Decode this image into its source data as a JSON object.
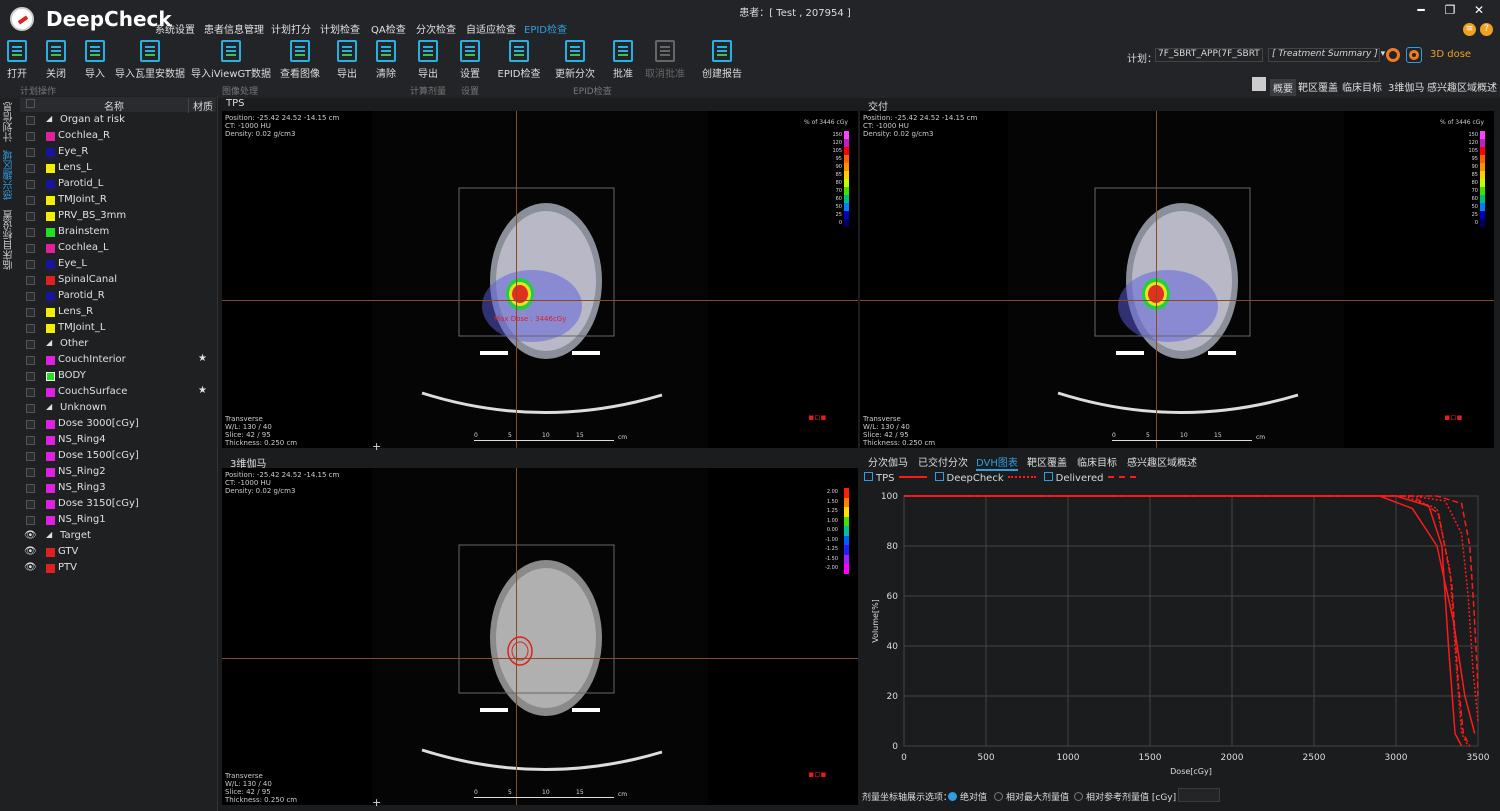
{
  "app": {
    "name": "DeepCheck",
    "patient": "患者：[ Test , 207954 ]"
  },
  "menu": [
    "系统设置",
    "患者信息管理",
    "计划打分",
    "计划检查",
    "QA检查",
    "分次检查",
    "自适应检查",
    "EPID检查"
  ],
  "toolbar": {
    "buttons": [
      "打开",
      "关闭",
      "导入",
      "导入瓦里安数据",
      "导入iViewGT数据",
      "查看图像",
      "导出",
      "清除",
      "导出",
      "设置",
      "EPID检查",
      "更新分次",
      "批准",
      "取消批准",
      "创建报告"
    ],
    "groups": [
      "计划操作",
      "图像处理",
      "计算剂量",
      "设置",
      "EPID检查"
    ]
  },
  "plan": {
    "label": "计划：",
    "value": "7F_SBRT_APP(7F_SBRT",
    "summary": "[ Treatment Summary ]",
    "dose3d": "3D dose"
  },
  "right_tabs": [
    "概要",
    "靶区覆盖",
    "临床目标",
    "3维伽马",
    "感兴趣区域概述"
  ],
  "side_tabs": [
    "计划信息",
    "感兴趣区域",
    "临床目标设置"
  ],
  "struct_header": {
    "name": "名称",
    "material": "材质"
  },
  "structures": [
    {
      "type": "group",
      "label": "Organ at risk"
    },
    {
      "label": "Cochlea_R",
      "color": "#e0209a"
    },
    {
      "label": "Eye_R",
      "color": "#1515a0"
    },
    {
      "label": "Lens_L",
      "color": "#f0f000"
    },
    {
      "label": "Parotid_L",
      "color": "#1515a0"
    },
    {
      "label": "TMJoint_R",
      "color": "#f0f000"
    },
    {
      "label": "PRV_BS_3mm",
      "color": "#f0f000"
    },
    {
      "label": "Brainstem",
      "color": "#20e020"
    },
    {
      "label": "Cochlea_L",
      "color": "#e0209a"
    },
    {
      "label": "Eye_L",
      "color": "#1515a0"
    },
    {
      "label": "SpinalCanal",
      "color": "#e02020"
    },
    {
      "label": "Parotid_R",
      "color": "#1515a0"
    },
    {
      "label": "Lens_R",
      "color": "#f0f000"
    },
    {
      "label": "TMJoint_L",
      "color": "#f0f000"
    },
    {
      "type": "group",
      "label": "Other"
    },
    {
      "label": "CouchInterior",
      "color": "#e020e0",
      "star": "★"
    },
    {
      "label": "BODY",
      "color": "#20e020"
    },
    {
      "label": "CouchSurface",
      "color": "#e020e0",
      "star": "★"
    },
    {
      "type": "group",
      "label": "Unknown"
    },
    {
      "label": "Dose 3000[cGy]",
      "color": "#e020e0"
    },
    {
      "label": "NS_Ring4",
      "color": "#e020e0"
    },
    {
      "label": "Dose 1500[cGy]",
      "color": "#e020e0"
    },
    {
      "label": "NS_Ring2",
      "color": "#e020e0"
    },
    {
      "label": "NS_Ring3",
      "color": "#e020e0"
    },
    {
      "label": "Dose 3150[cGy]",
      "color": "#e020e0"
    },
    {
      "label": "NS_Ring1",
      "color": "#e020e0"
    },
    {
      "type": "group",
      "label": "Target",
      "eye": true
    },
    {
      "label": "GTV",
      "color": "#e02020",
      "eye": true
    },
    {
      "label": "PTV",
      "color": "#e02020",
      "eye": true
    }
  ],
  "panels": {
    "tps": "TPS",
    "delivered": "交付",
    "gamma3d": "3维伽马",
    "info_top": "Position: -25.42 24.52 -14.15 cm\nCT: -1000 HU\nDensity: 0.02 g/cm3",
    "info_bottom": "Transverse\nW/L: 130 / 40\nSlice: 42 / 95\nThickness: 0.250 cm",
    "maxdose": "Max Dose : 3446cGy",
    "colorbar_title": "% of 3446 cGy",
    "dose_ticks": [
      "150",
      "120",
      "105",
      "95",
      "90",
      "85",
      "80",
      "70",
      "60",
      "50",
      "25",
      "0"
    ],
    "gamma_ticks": [
      "2.00",
      "1.50",
      "1.25",
      "1.00",
      "0.00",
      "-1.00",
      "-1.25",
      "-1.50",
      "-2.00"
    ],
    "scale_ticks": [
      "0",
      "5",
      "10",
      "15"
    ],
    "scale_unit": "cm"
  },
  "bottom_tabs": [
    "分次伽马",
    "已交付分次",
    "DVH图表",
    "靶区覆盖",
    "临床目标",
    "感兴趣区域概述"
  ],
  "chart_legend": [
    "TPS",
    "DeepCheck",
    "Delivered"
  ],
  "chart_data": {
    "type": "line",
    "xlabel": "Dose[cGy]",
    "ylabel": "Volume[%]",
    "xlim": [
      0,
      3500
    ],
    "ylim": [
      0,
      100
    ],
    "xticks": [
      0,
      500,
      1000,
      1500,
      2000,
      2500,
      3000,
      3500
    ],
    "yticks": [
      0,
      20,
      40,
      60,
      80,
      100
    ],
    "grid": true,
    "series": [
      {
        "name": "TPS",
        "style": "solid",
        "x": [
          0,
          3000,
          3200,
          3280,
          3320,
          3360,
          3400
        ],
        "y": [
          100,
          100,
          96,
          80,
          40,
          5,
          0
        ]
      },
      {
        "name": "TPS",
        "style": "solid",
        "x": [
          0,
          2900,
          3100,
          3250,
          3350,
          3420,
          3480
        ],
        "y": [
          100,
          100,
          95,
          80,
          50,
          20,
          5
        ]
      },
      {
        "name": "DeepCheck",
        "style": "dotted",
        "x": [
          0,
          3050,
          3250,
          3330,
          3370,
          3400,
          3440
        ],
        "y": [
          100,
          100,
          95,
          70,
          30,
          5,
          0
        ]
      },
      {
        "name": "DeepCheck",
        "style": "dotted",
        "x": [
          0,
          3100,
          3300,
          3400,
          3440,
          3470,
          3500
        ],
        "y": [
          100,
          100,
          98,
          85,
          60,
          30,
          10
        ]
      },
      {
        "name": "Delivered",
        "style": "dashed",
        "x": [
          0,
          3100,
          3260,
          3340,
          3380,
          3410,
          3450
        ],
        "y": [
          100,
          100,
          93,
          65,
          25,
          5,
          0
        ]
      },
      {
        "name": "Delivered",
        "style": "dashed",
        "x": [
          0,
          3250,
          3400,
          3450,
          3475,
          3495,
          3500
        ],
        "y": [
          100,
          100,
          97,
          80,
          55,
          30,
          20
        ]
      }
    ]
  },
  "options": {
    "label": "剂量坐标轴展示选项：",
    "items": [
      "绝对值",
      "相对最大剂量值",
      "相对参考剂量值 [cGy]"
    ],
    "selected": 0
  },
  "colors": {
    "accent": "#2f9de0",
    "dvh": "#ff1a1a"
  }
}
